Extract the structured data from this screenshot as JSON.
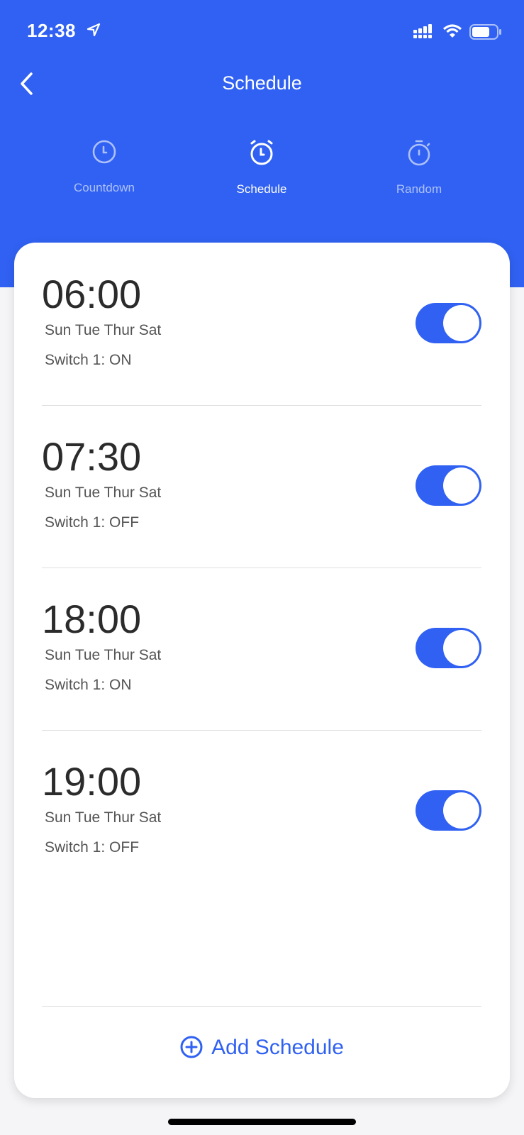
{
  "status_bar": {
    "time": "12:38"
  },
  "header": {
    "title": "Schedule"
  },
  "tabs": [
    {
      "label": "Countdown",
      "icon": "clock-icon",
      "active": false
    },
    {
      "label": "Schedule",
      "icon": "alarm-clock-icon",
      "active": true
    },
    {
      "label": "Random",
      "icon": "stopwatch-icon",
      "active": false
    }
  ],
  "schedules": [
    {
      "time": "06:00",
      "days": "Sun Tue Thur Sat",
      "action": "Switch 1: ON",
      "enabled": true
    },
    {
      "time": "07:30",
      "days": "Sun Tue Thur Sat",
      "action": "Switch 1: OFF",
      "enabled": true
    },
    {
      "time": "18:00",
      "days": "Sun Tue Thur Sat",
      "action": "Switch 1: ON",
      "enabled": true
    },
    {
      "time": "19:00",
      "days": "Sun Tue Thur Sat",
      "action": "Switch 1: OFF",
      "enabled": true
    }
  ],
  "add_button": {
    "label": "Add Schedule"
  },
  "colors": {
    "accent": "#3061f2"
  }
}
